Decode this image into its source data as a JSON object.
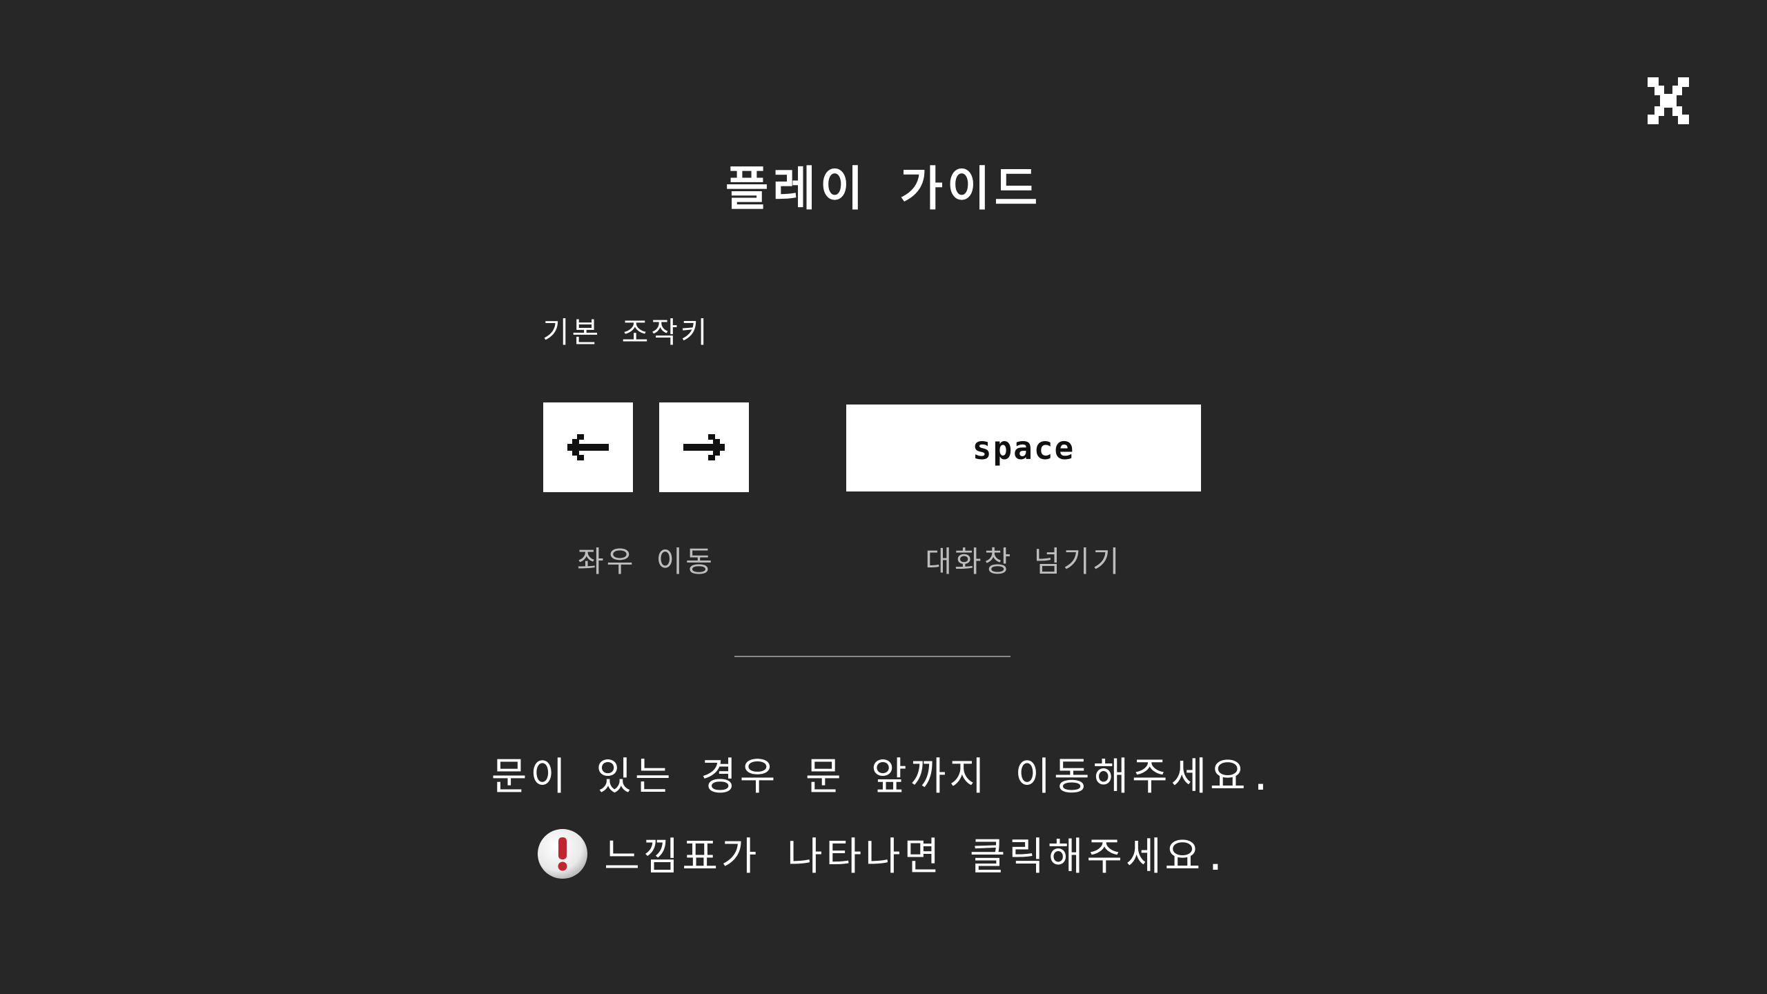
{
  "title": "플레이 가이드",
  "close": {
    "icon": "close-icon"
  },
  "controls": {
    "section_label": "기본 조작키",
    "keys": {
      "left_icon": "arrow-left-icon",
      "right_icon": "arrow-right-icon",
      "space_label": "space"
    },
    "captions": {
      "move": "좌우 이동",
      "space": "대화창 넘기기"
    }
  },
  "tips": {
    "line1": "문이 있는 경우 문 앞까지 이동해주세요.",
    "line2": "느낌표가 나타나면 클릭해주세요.",
    "line2_icon": "exclamation-badge-icon"
  },
  "colors": {
    "background": "#272727",
    "text": "#ffffff",
    "caption": "#bdbdbd",
    "key_bg": "#ffffff",
    "badge_red": "#c0262d"
  }
}
